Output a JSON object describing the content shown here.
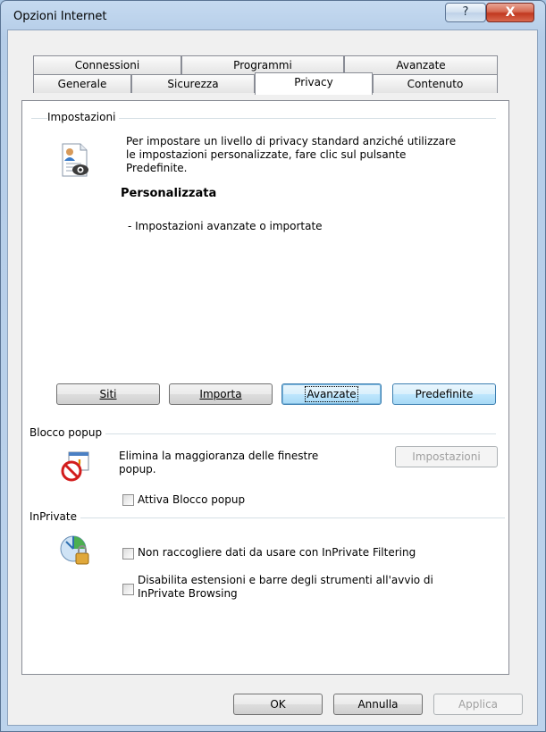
{
  "window": {
    "title": "Opzioni Internet"
  },
  "titlebar": {
    "help_label": "?",
    "close_label": "X"
  },
  "tabs": {
    "row1": [
      "Connessioni",
      "Programmi",
      "Avanzate"
    ],
    "row2": [
      "Generale",
      "Sicurezza",
      "Privacy",
      "Contenuto"
    ],
    "selected": "Privacy"
  },
  "impostazioni": {
    "group_label": "Impostazioni",
    "description_lines": [
      "Per impostare un livello di privacy standard anziché utilizzare",
      "le impostazioni personalizzate, fare clic sul pulsante",
      "Predefinite."
    ],
    "level_title": "Personalizzata",
    "level_detail": "- Impostazioni avanzate o importate",
    "buttons": {
      "siti": "Siti",
      "importa": "Importa",
      "avanzate": "Avanzate",
      "predefinite": "Predefinite"
    }
  },
  "popup": {
    "group_label": "Blocco popup",
    "description_lines": [
      "Elimina la maggioranza delle finestre",
      "popup."
    ],
    "settings_button": "Impostazioni",
    "checkbox_label": "Attiva Blocco popup",
    "checkbox_checked": false
  },
  "inprivate": {
    "group_label": "InPrivate",
    "filtering_label": "Non raccogliere dati da usare con InPrivate Filtering",
    "filtering_checked": false,
    "disable_lines": [
      "Disabilita estensioni e barre degli strumenti all'avvio di",
      "InPrivate Browsing"
    ],
    "disable_checked": false
  },
  "footer": {
    "ok": "OK",
    "annulla": "Annulla",
    "applica": "Applica"
  }
}
